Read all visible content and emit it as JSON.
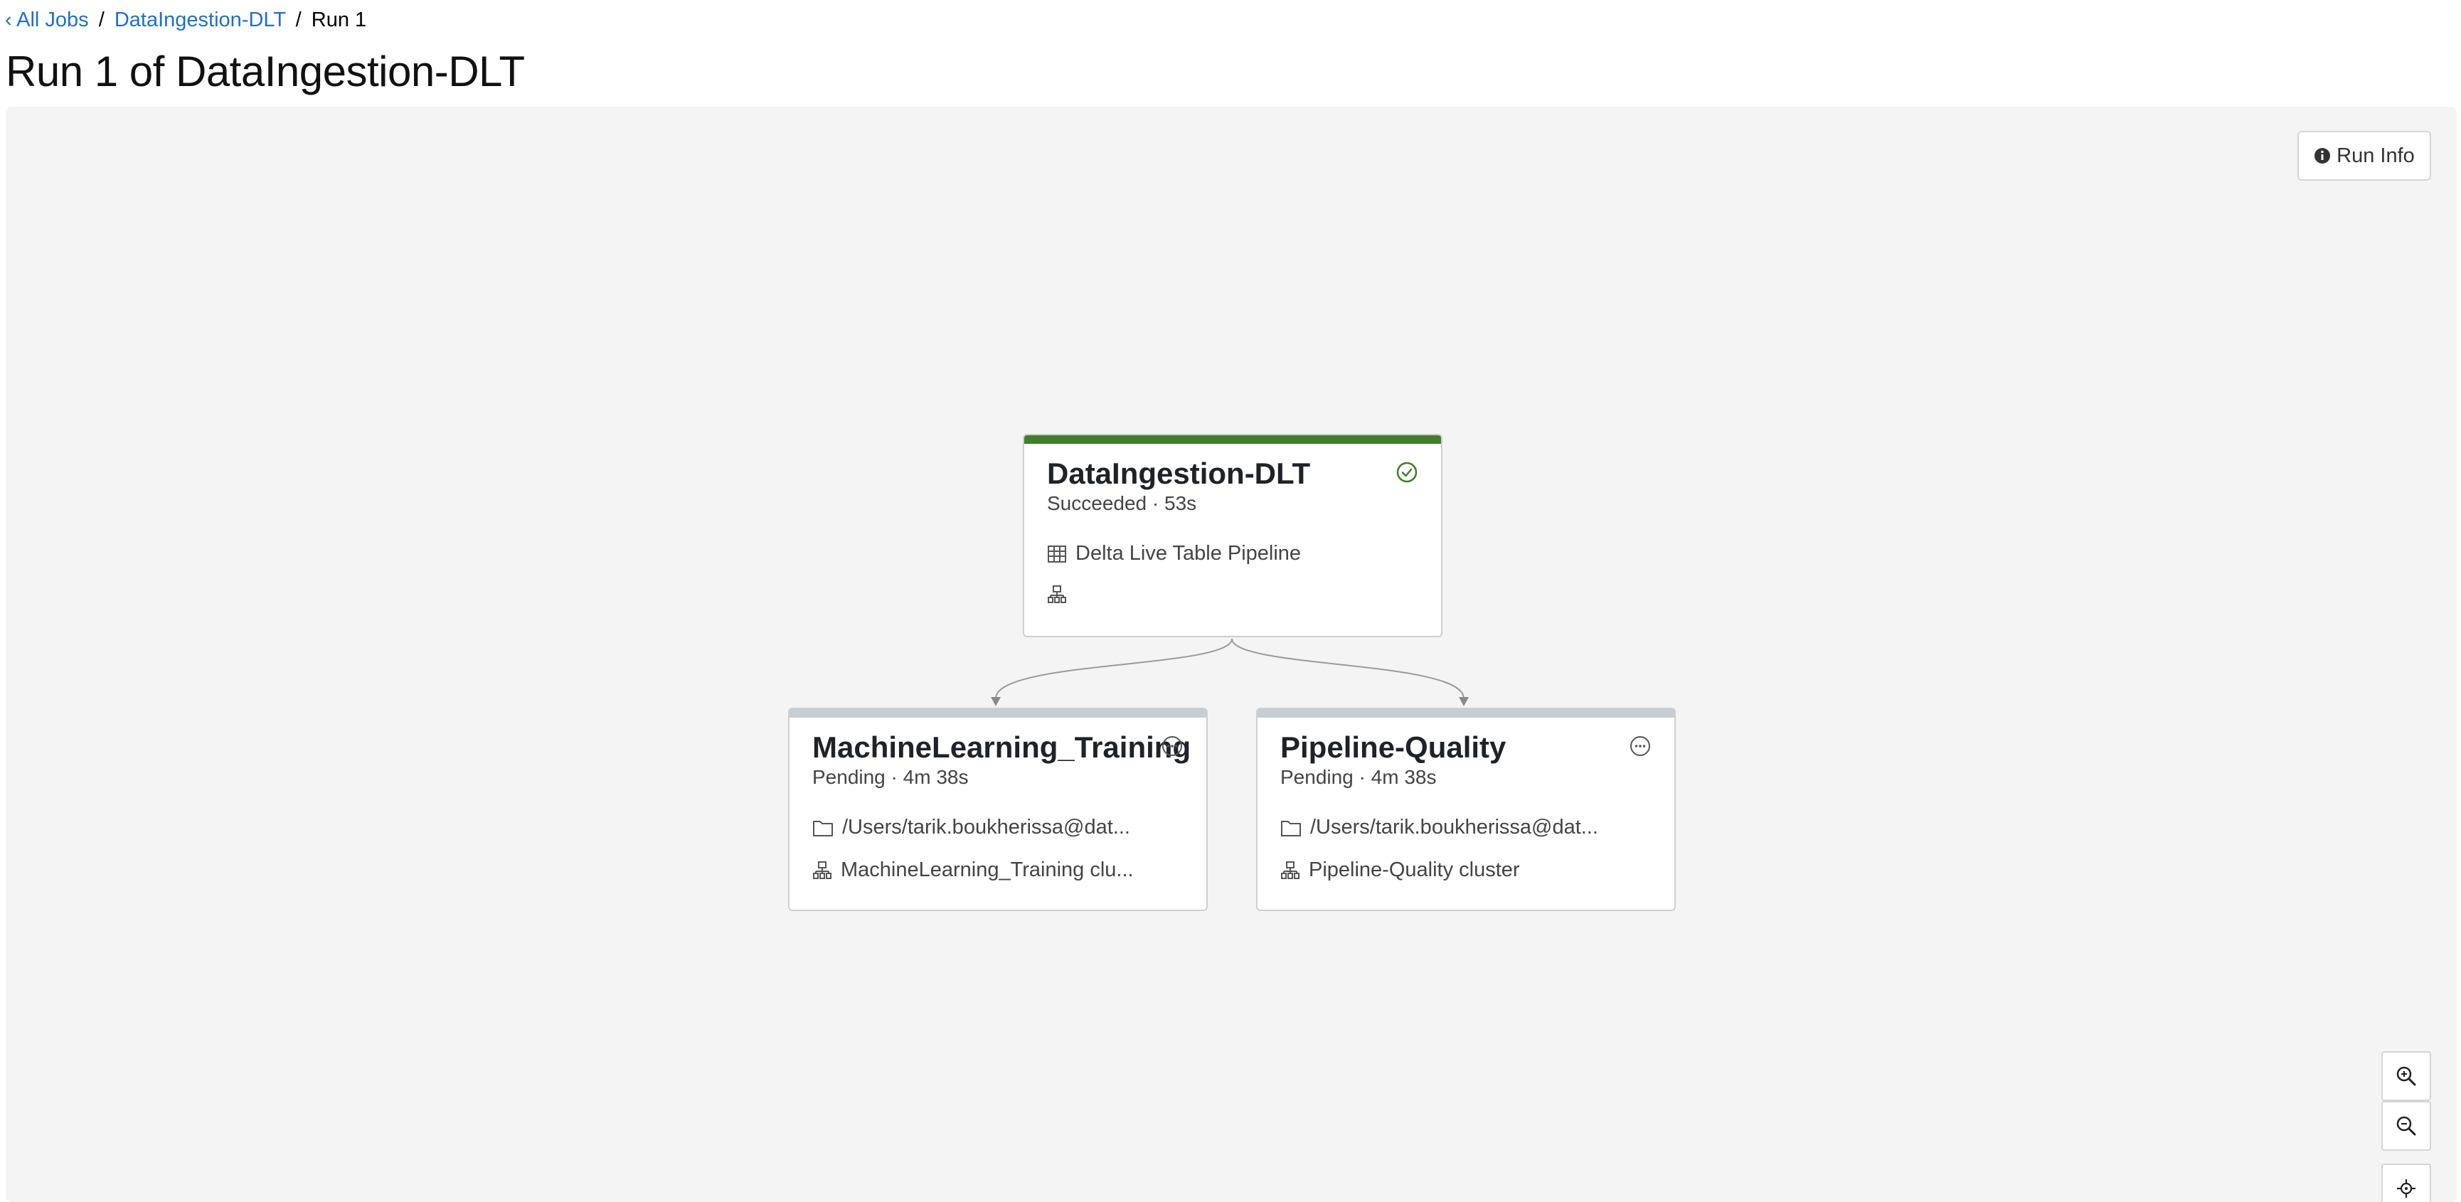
{
  "breadcrumb": {
    "back_label": "‹ All Jobs",
    "job_label": "DataIngestion-DLT",
    "current_label": "Run 1",
    "separator": "/"
  },
  "page_title": "Run 1 of DataIngestion-DLT",
  "toolbar": {
    "run_info_label": "Run Info"
  },
  "tasks": [
    {
      "name": "DataIngestion-DLT",
      "status": "Succeeded · 53s",
      "status_color": "#3f7f2a",
      "state_icon": "check-circle-icon",
      "type_icon": "table-icon",
      "type_label": "Delta Live Table Pipeline",
      "cluster_icon": "cluster-icon",
      "cluster_label": ""
    },
    {
      "name": "MachineLearning_Training",
      "status": "Pending · 4m 38s",
      "status_color": "#c8cdd2",
      "state_icon": "pending-icon",
      "type_icon": "folder-icon",
      "type_label": "/Users/tarik.boukherissa@dat...",
      "cluster_icon": "cluster-icon",
      "cluster_label": "MachineLearning_Training clu..."
    },
    {
      "name": "Pipeline-Quality",
      "status": "Pending · 4m 38s",
      "status_color": "#c8cdd2",
      "state_icon": "pending-icon",
      "type_icon": "folder-icon",
      "type_label": "/Users/tarik.boukherissa@dat...",
      "cluster_icon": "cluster-icon",
      "cluster_label": "Pipeline-Quality cluster"
    }
  ],
  "zoom_controls": {
    "zoom_in_icon": "zoom-in-icon",
    "zoom_out_icon": "zoom-out-icon",
    "recenter_icon": "crosshair-icon"
  },
  "colors": {
    "link": "#1f6fc9",
    "success": "#3f7f2a",
    "pending": "#c8cdd2",
    "canvas_bg": "#f4f4f4"
  }
}
